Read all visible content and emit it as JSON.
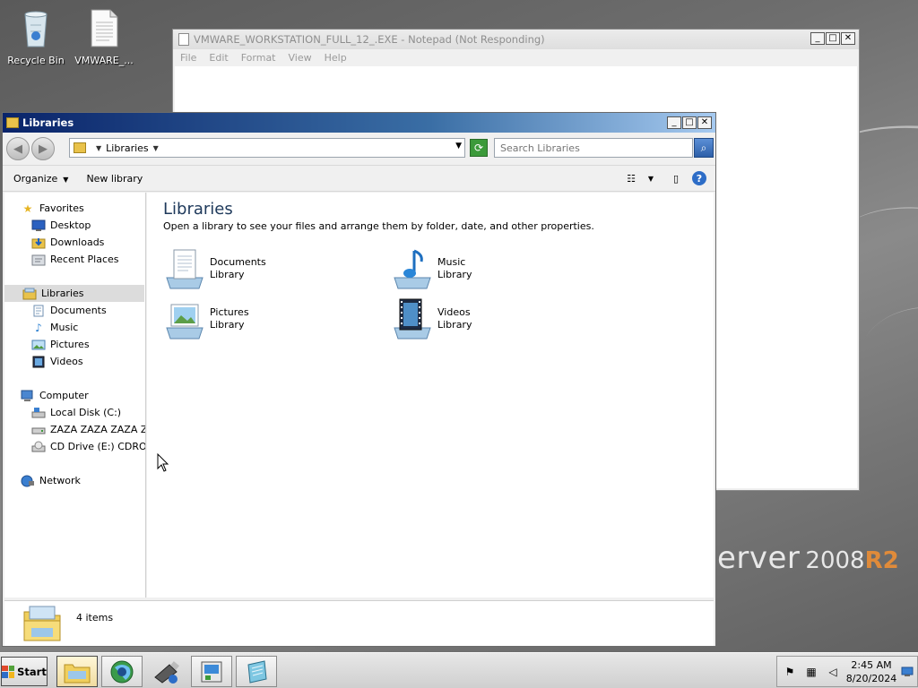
{
  "desktop": {
    "icons": [
      {
        "label": "Recycle Bin",
        "icon": "recycle-bin-icon"
      },
      {
        "label": "VMWARE_...",
        "icon": "document-icon"
      }
    ],
    "branding": {
      "part1": "erver",
      "part2": "2008",
      "part3": "R2"
    }
  },
  "notepad": {
    "title": "VMWARE_WORKSTATION_FULL_12_.EXE - Notepad (Not Responding)",
    "menu": [
      "File",
      "Edit",
      "Format",
      "View",
      "Help"
    ]
  },
  "explorer": {
    "title": "Libraries",
    "address": {
      "root_label": "Libraries"
    },
    "search": {
      "placeholder": "Search Libraries"
    },
    "toolbar": {
      "organize": "Organize",
      "new_library": "New library"
    },
    "nav": {
      "favorites": {
        "label": "Favorites",
        "items": [
          "Desktop",
          "Downloads",
          "Recent Places"
        ]
      },
      "libraries": {
        "label": "Libraries",
        "items": [
          "Documents",
          "Music",
          "Pictures",
          "Videos"
        ]
      },
      "computer": {
        "label": "Computer",
        "items": [
          "Local Disk (C:)",
          "ZAZA ZAZA ZAZA ZAZ",
          "CD Drive (E:) CDROM"
        ]
      },
      "network": {
        "label": "Network"
      }
    },
    "content": {
      "heading": "Libraries",
      "description": "Open a library to see your files and arrange them by folder, date, and other properties.",
      "libraries": [
        {
          "name": "Documents",
          "type": "Library",
          "icon": "documents-library-icon"
        },
        {
          "name": "Music",
          "type": "Library",
          "icon": "music-library-icon"
        },
        {
          "name": "Pictures",
          "type": "Library",
          "icon": "pictures-library-icon"
        },
        {
          "name": "Videos",
          "type": "Library",
          "icon": "videos-library-icon"
        }
      ]
    },
    "details": {
      "count": "4 items"
    }
  },
  "taskbar": {
    "start_label": "Start",
    "apps": [
      {
        "name": "windows-explorer",
        "icon": "explorer-folder-icon",
        "active": true
      },
      {
        "name": "internet-explorer",
        "icon": "globe-icon",
        "active": false
      },
      {
        "name": "usb-device",
        "icon": "usb-icon",
        "active": false
      },
      {
        "name": "server-manager",
        "icon": "server-manager-icon",
        "active": false
      },
      {
        "name": "notepad",
        "icon": "notepad-icon",
        "active": false
      }
    ],
    "tray": {
      "icons": [
        "flag-icon",
        "network-icon",
        "volume-icon",
        "show-desktop-icon"
      ],
      "time": "2:45 AM",
      "date": "8/20/2024"
    }
  }
}
